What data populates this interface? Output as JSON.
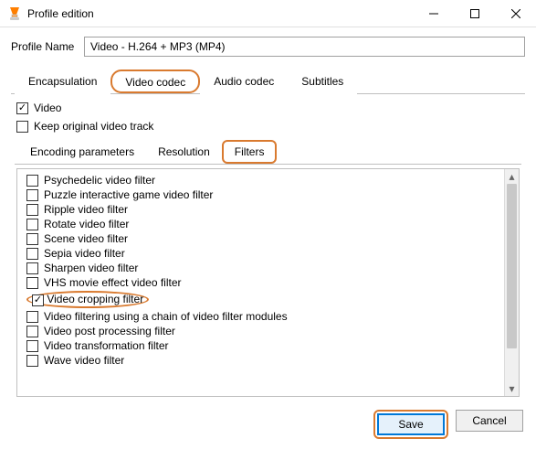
{
  "titlebar": {
    "title": "Profile edition"
  },
  "profile": {
    "label": "Profile Name",
    "value": "Video - H.264 + MP3 (MP4)"
  },
  "maintabs": {
    "encapsulation": "Encapsulation",
    "video_codec": "Video codec",
    "audio_codec": "Audio codec",
    "subtitles": "Subtitles"
  },
  "checks": {
    "video": "Video",
    "keep_original": "Keep original video track"
  },
  "subtabs": {
    "encoding": "Encoding parameters",
    "resolution": "Resolution",
    "filters": "Filters"
  },
  "filters": [
    {
      "label": "Psychedelic video filter",
      "checked": false
    },
    {
      "label": "Puzzle interactive game video filter",
      "checked": false
    },
    {
      "label": "Ripple video filter",
      "checked": false
    },
    {
      "label": "Rotate video filter",
      "checked": false
    },
    {
      "label": "Scene video filter",
      "checked": false
    },
    {
      "label": "Sepia video filter",
      "checked": false
    },
    {
      "label": "Sharpen video filter",
      "checked": false
    },
    {
      "label": "VHS movie effect video filter",
      "checked": false
    },
    {
      "label": "Video cropping filter",
      "checked": true,
      "highlight": true
    },
    {
      "label": "Video filtering using a chain of video filter modules",
      "checked": false
    },
    {
      "label": "Video post processing filter",
      "checked": false
    },
    {
      "label": "Video transformation filter",
      "checked": false
    },
    {
      "label": "Wave video filter",
      "checked": false
    }
  ],
  "buttons": {
    "save": "Save",
    "cancel": "Cancel"
  }
}
